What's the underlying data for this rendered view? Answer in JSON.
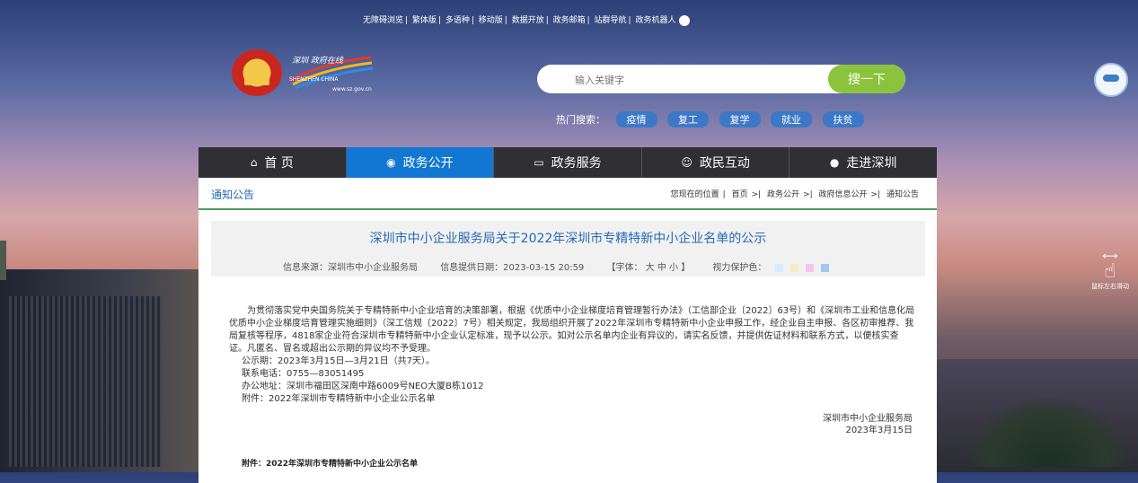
{
  "toplinks": [
    "无障碍浏览",
    "繁体版",
    "多语种",
    "移动版",
    "数据开放",
    "政务邮箱",
    "站群导航",
    "政务机器人"
  ],
  "logo": {
    "cn": "深圳 政府在线",
    "en": "SHENZHEN CHINA",
    "url": "www.sz.gov.cn"
  },
  "search": {
    "placeholder": "输入关键字",
    "button": "搜一下"
  },
  "hot": {
    "label": "热门搜索：",
    "tags": [
      "疫情",
      "复工",
      "复学",
      "就业",
      "扶贫"
    ]
  },
  "nav": [
    {
      "label": "首 页",
      "icon": "home-icon",
      "glyph": "⌂"
    },
    {
      "label": "政务公开",
      "icon": "eye-icon",
      "glyph": "◉"
    },
    {
      "label": "政务服务",
      "icon": "monitor-icon",
      "glyph": "▭"
    },
    {
      "label": "政民互动",
      "icon": "people-icon",
      "glyph": "☺"
    },
    {
      "label": "走进深圳",
      "icon": "info-icon",
      "glyph": "●"
    }
  ],
  "nav_active": 1,
  "section": "通知公告",
  "breadcrumb": {
    "label": "您现在的位置",
    "items": [
      "首页",
      "政务公开",
      "政府信息公开",
      "通知公告"
    ]
  },
  "article": {
    "title": "深圳市中小企业服务局关于2022年深圳市专精特新中小企业名单的公示",
    "source": "信息来源：深圳市中小企业服务局",
    "date": "信息提供日期：2023-03-15 20:59",
    "fontsize": "【字体： 大 中 小 】",
    "vision": "视力保护色：",
    "swatches": [
      "#d6ecfa",
      "#fbe8c8",
      "#f6c4f0",
      "#9ec8ee"
    ],
    "para": "为贯彻落实党中央国务院关于专精特新中小企业培育的决策部署，根据《优质中小企业梯度培育管理暂行办法》（工信部企业〔2022〕63号）和《深圳市工业和信息化局优质中小企业梯度培育管理实施细则》（深工信规〔2022〕7号）相关规定，我局组织开展了2022年深圳市专精特新中小企业申报工作，经企业自主申报、各区初审推荐、我局复核等程序，4818家企业符合深圳市专精特新中小企业认定标准，现予以公示。如对公示名单内企业有异议的，请实名反馈，并提供佐证材料和联系方式，以便核实查证。凡匿名、冒名或超出公示期的异议均不予受理。",
    "period": "公示期：2023年3月15日—3月21日（共7天）。",
    "phone": "联系电话：0755—83051495",
    "address": "办公地址：深圳市福田区深南中路6009号NEO大厦B栋1012",
    "attachment": "附件：2022年深圳市专精特新中小企业公示名单",
    "signer": "深圳市中小企业服务局",
    "sign_date": "2023年3月15日",
    "attach_title": "附件：2022年深圳市专精特新中小企业公示名单"
  },
  "side": {
    "hand_label": "鼠标左右滑动"
  }
}
